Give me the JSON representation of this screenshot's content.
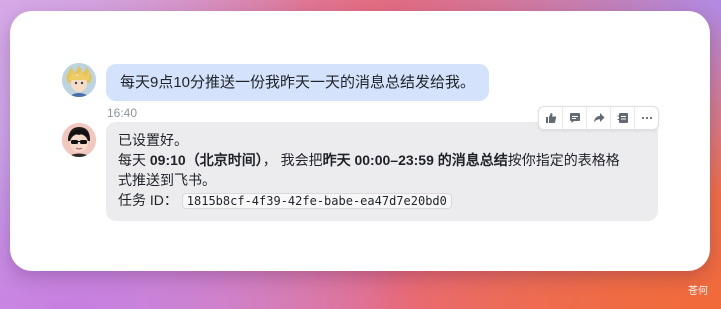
{
  "chat": {
    "user_message": "每天9点10分推送一份我昨天一天的消息总结发给我。",
    "timestamp": "16:40",
    "bot_reply": {
      "line1": "已设置好。",
      "line2_prefix": "每天 ",
      "line2_time": "09:10（北京时间）",
      "line2_mid": "， 我会把",
      "line2_range": "昨天 00:00–23:59 的消息总结",
      "line2_suffix": "按你指定的表格格",
      "line3": "式推送到飞书。",
      "task_label": "任务 ID：",
      "task_id": "1815b8cf-4f39-42fe-babe-ea47d7e20bd0"
    }
  },
  "actions": [
    {
      "icon": "thumbs-up-icon"
    },
    {
      "icon": "comment-icon"
    },
    {
      "icon": "forward-icon"
    },
    {
      "icon": "edit-note-icon"
    },
    {
      "icon": "more-icon"
    }
  ],
  "watermark": "苍何",
  "colors": {
    "user_bubble": "#d4e3fb",
    "bot_bubble": "#ececee"
  }
}
